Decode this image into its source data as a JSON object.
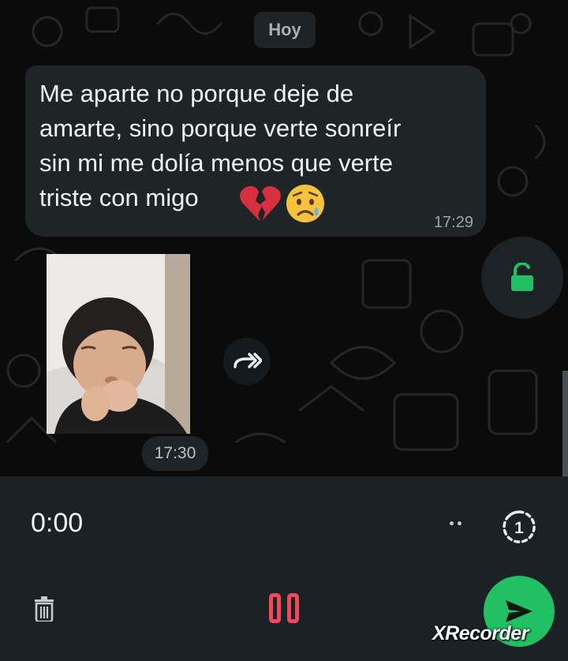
{
  "chat": {
    "date_chip": "Hoy",
    "message": {
      "text": "Me aparte no porque deje de\namarte, sino porque verte sonreír\nsin mi  me dolía menos que verte\ntriste con migo",
      "emoji_1": "💔",
      "emoji_2": "😥",
      "time": "17:29"
    },
    "photo": {
      "time": "17:30"
    },
    "icons": {
      "unlock": "lock-open-icon",
      "forward": "forward-icon"
    }
  },
  "recorder": {
    "timer": "0:00",
    "view_once_label": "1",
    "icons": {
      "more": "more-dots-icon",
      "view_once": "view-once-icon",
      "delete": "trash-icon",
      "pause": "pause-icon",
      "send": "send-icon"
    }
  },
  "watermark": "XRecorder",
  "colors": {
    "accent_green": "#21c063",
    "pause_red": "#f04a5a",
    "bubble_bg": "#1f2427",
    "panel_bg": "#1c2126"
  }
}
